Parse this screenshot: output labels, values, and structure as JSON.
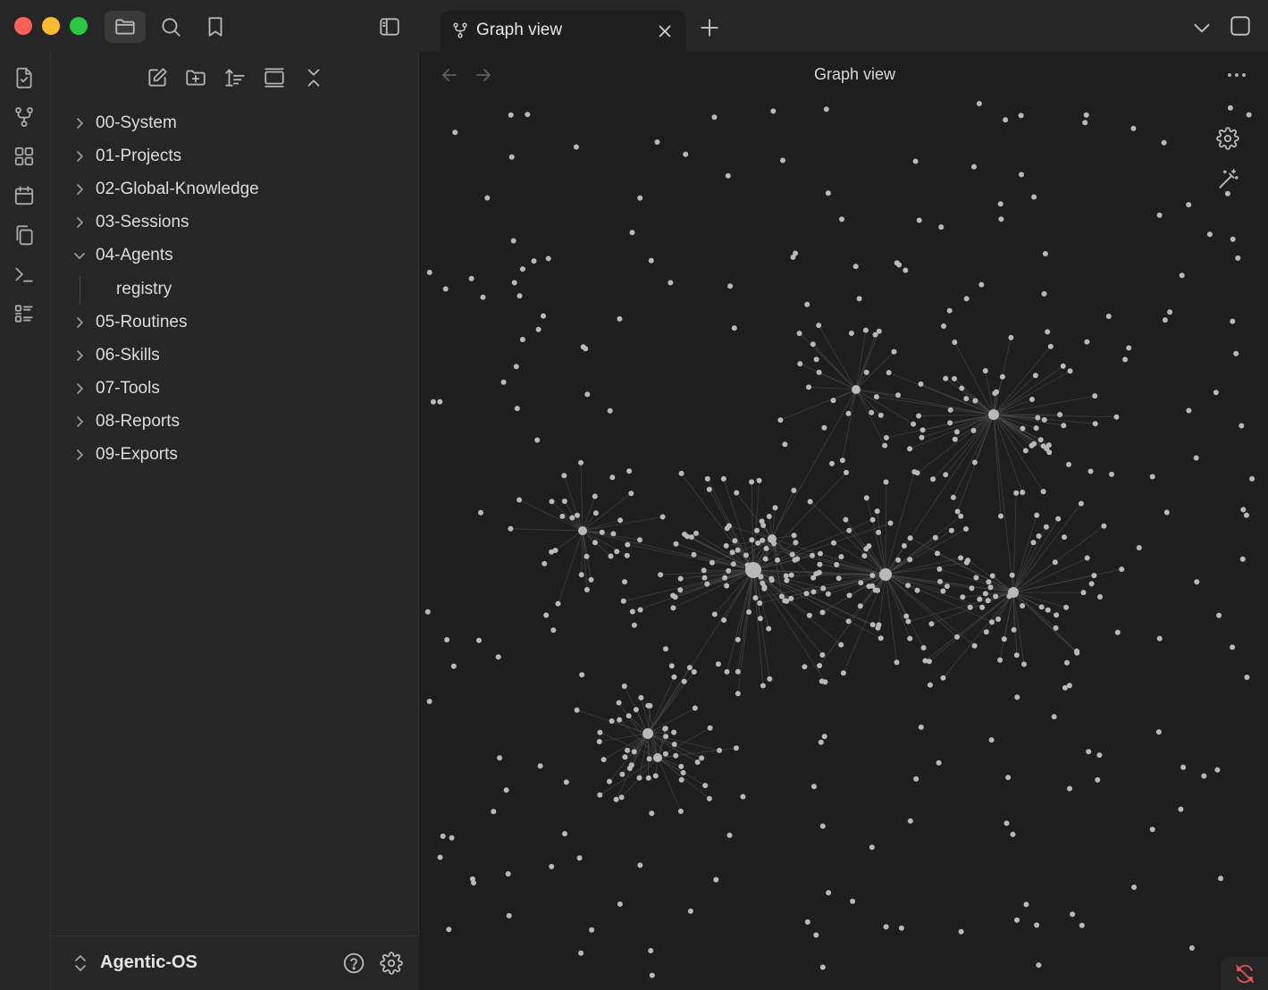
{
  "app": {
    "window_title": "Graph view",
    "colors": {
      "background": "#1e1e1e",
      "sidebar": "#262626",
      "titlebar": "#262626",
      "node": "#b9b9b9",
      "edge": "#4a4a4a",
      "accent_status": "#e0535c"
    }
  },
  "titlebar": {
    "traffic_lights": [
      "close",
      "minimize",
      "zoom"
    ],
    "buttons": [
      {
        "name": "file-explorer",
        "icon": "folder-icon",
        "active": true
      },
      {
        "name": "search",
        "icon": "search-icon",
        "active": false
      },
      {
        "name": "bookmarks",
        "icon": "bookmark-icon",
        "active": false
      }
    ],
    "sidebar_toggle_icon": "sidebar-left-icon",
    "tabs": [
      {
        "title": "Graph view",
        "icon": "git-fork-icon",
        "active": true
      }
    ],
    "new_tab_icon": "plus-icon",
    "tab_list_icon": "chevron-down-icon",
    "window_icon": "square-icon"
  },
  "ribbon": {
    "items": [
      {
        "name": "open-quick-switcher",
        "icon": "file-icon"
      },
      {
        "name": "open-graph-view",
        "icon": "git-fork-icon"
      },
      {
        "name": "open-canvas",
        "icon": "grid-icon"
      },
      {
        "name": "open-daily-note",
        "icon": "calendar-icon"
      },
      {
        "name": "templates",
        "icon": "copy-icon"
      },
      {
        "name": "terminal",
        "icon": "terminal-icon"
      },
      {
        "name": "outline",
        "icon": "list-icon"
      }
    ]
  },
  "explorer": {
    "toolbar": [
      {
        "name": "new-note",
        "icon": "edit-icon"
      },
      {
        "name": "new-folder",
        "icon": "folder-plus-icon"
      },
      {
        "name": "change-sort-order",
        "icon": "sort-icon"
      },
      {
        "name": "auto-reveal",
        "icon": "reveal-icon"
      },
      {
        "name": "collapse-all",
        "icon": "collapse-icon"
      }
    ],
    "folders": [
      {
        "label": "00-System",
        "expanded": false
      },
      {
        "label": "01-Projects",
        "expanded": false
      },
      {
        "label": "02-Global-Knowledge",
        "expanded": false
      },
      {
        "label": "03-Sessions",
        "expanded": false
      },
      {
        "label": "04-Agents",
        "expanded": true,
        "children": [
          "registry"
        ]
      },
      {
        "label": "05-Routines",
        "expanded": false
      },
      {
        "label": "06-Skills",
        "expanded": false
      },
      {
        "label": "07-Tools",
        "expanded": false
      },
      {
        "label": "08-Reports",
        "expanded": false
      },
      {
        "label": "09-Exports",
        "expanded": false
      }
    ]
  },
  "vault": {
    "name": "Agentic-OS",
    "switch_icon": "chevrons-up-down-icon",
    "help_icon": "help-circle-icon",
    "settings_icon": "gear-icon"
  },
  "graph_view": {
    "title": "Graph view",
    "nav_back_icon": "arrow-left-icon",
    "nav_forward_icon": "arrow-right-icon",
    "more_options_icon": "more-horizontal-icon",
    "controls": [
      {
        "name": "graph-settings",
        "icon": "gear-icon"
      },
      {
        "name": "animate",
        "icon": "magic-wand-icon"
      }
    ],
    "status_icon": "sync-off-icon"
  }
}
